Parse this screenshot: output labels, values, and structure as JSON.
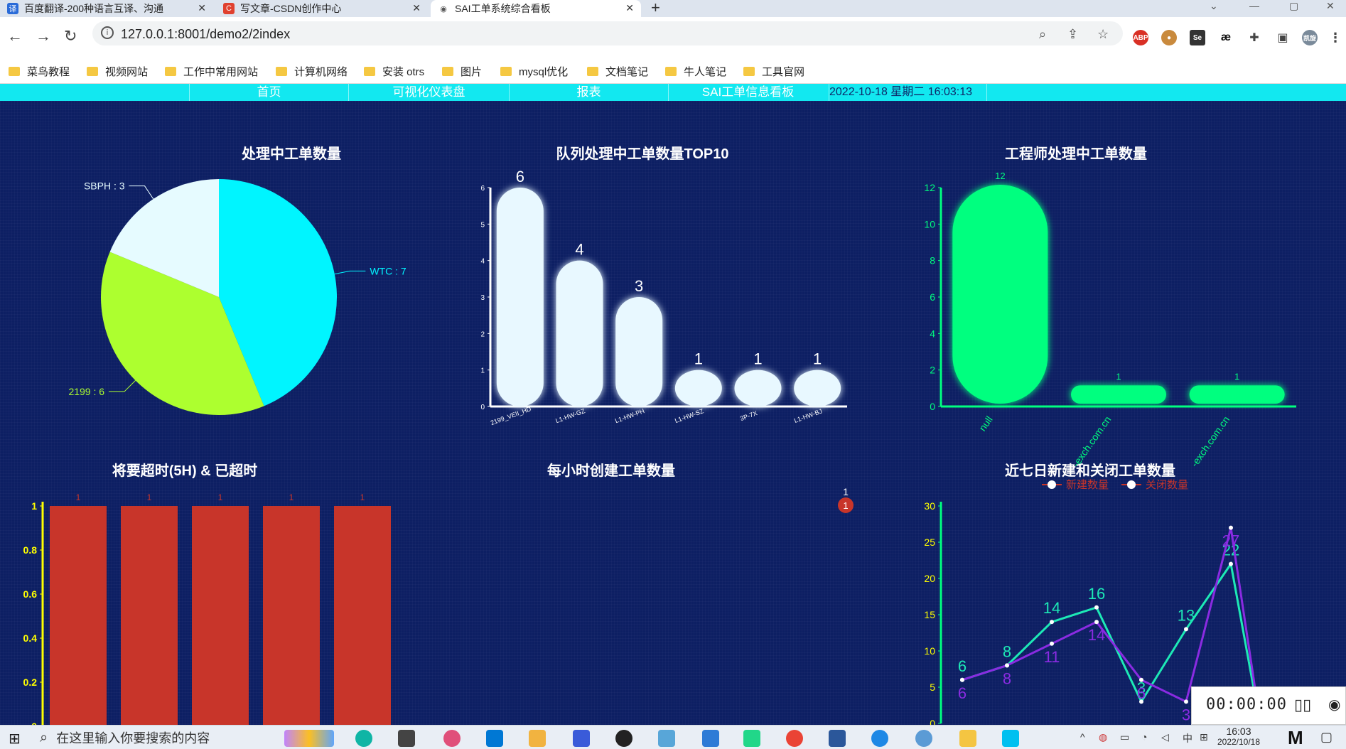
{
  "browser": {
    "tabs": [
      {
        "label": "百度翻译-200种语言互译、沟通",
        "favicon": "译",
        "color": "#2a6bd8"
      },
      {
        "label": "写文章-CSDN创作中心",
        "favicon": "C",
        "color": "#e0412f"
      },
      {
        "label": "SAI工单系统综合看板",
        "favicon": "◉",
        "color": "#555555"
      }
    ],
    "url": "127.0.0.1:8001/demo2/2index",
    "bookmarks": [
      "菜鸟教程",
      "视频网站",
      "工作中常用网站",
      "计算机网络",
      "安装 otrs",
      "图片",
      "mysql优化",
      "文档笔记",
      "牛人笔记",
      "工具官网"
    ],
    "profile": "凯旋"
  },
  "nav": {
    "items": [
      "首页",
      "可视化仪表盘",
      "报表",
      "SAI工单信息看板"
    ],
    "datetime": "2022-10-18 星期二 16:03:13"
  },
  "colors": {
    "cyan": "#00f5ff",
    "lime": "#adff2f",
    "green": "#00ff7f",
    "red": "#c8352a",
    "purple": "#8a2be2",
    "teal": "#1de9b6"
  },
  "charts": {
    "pie_title": "处理中工单数量",
    "queue_title": "队列处理中工单数量TOP10",
    "engineer_title": "工程师处理中工单数量",
    "overdue_title": "将要超时(5H) & 已超时",
    "hourly_title": "每小时创建工单数量",
    "weekly_title": "近七日新建和关闭工单数量"
  },
  "chart_data": [
    {
      "type": "pie",
      "title": "处理中工单数量",
      "slices": [
        {
          "name": "WTC",
          "value": 7,
          "color": "#00f5ff"
        },
        {
          "name": "2199",
          "value": 6,
          "color": "#adff2f"
        },
        {
          "name": "SBPH",
          "value": 3,
          "color": "#e6fbff"
        }
      ]
    },
    {
      "type": "bar",
      "title": "队列处理中工单数量TOP10",
      "categories": [
        "2199_VEII_HD",
        "L1-HW-GZ",
        "L1-HW-PH",
        "L1-HW-SZ",
        "3P-7X",
        "L1-HW-BJ"
      ],
      "values": [
        6,
        4,
        3,
        1,
        1,
        1
      ],
      "ylim": [
        0,
        6
      ],
      "yticks": [
        0,
        1,
        2,
        3,
        4,
        5,
        6
      ]
    },
    {
      "type": "bar",
      "title": "工程师处理中工单数量",
      "categories": [
        "null",
        "-exch.com.cn",
        "-exch.com.cn"
      ],
      "values": [
        12,
        1,
        1
      ],
      "ylim": [
        0,
        12
      ],
      "yticks": [
        0,
        2,
        4,
        6,
        8,
        10,
        12
      ]
    },
    {
      "type": "bar",
      "title": "将要超时(5H) & 已超时",
      "values": [
        1,
        1,
        1,
        1,
        1
      ],
      "ylim": [
        0,
        1
      ],
      "yticks": [
        "0",
        "0.2",
        "0.4",
        "0.6",
        "0.8",
        "1"
      ]
    },
    {
      "type": "scatter",
      "title": "每小时创建工单数量",
      "points": [
        {
          "value": 1
        }
      ]
    },
    {
      "type": "line",
      "title": "近七日新建和关闭工单数量",
      "series": [
        {
          "name": "新建数量",
          "values": [
            6,
            8,
            14,
            16,
            3,
            13,
            22
          ],
          "color": "#1de9b6"
        },
        {
          "name": "关闭数量",
          "values": [
            6,
            8,
            11,
            14,
            6,
            3,
            27
          ],
          "color": "#8a2be2"
        }
      ],
      "ylim": [
        0,
        30
      ],
      "yticks": [
        0,
        5,
        10,
        15,
        20,
        25,
        30
      ]
    }
  ],
  "recorder": {
    "time": "00:00:00"
  },
  "taskbar": {
    "search_placeholder": "在这里输入你要搜索的内容",
    "time": "16:03",
    "date": "2022/10/18",
    "ime": "中"
  }
}
